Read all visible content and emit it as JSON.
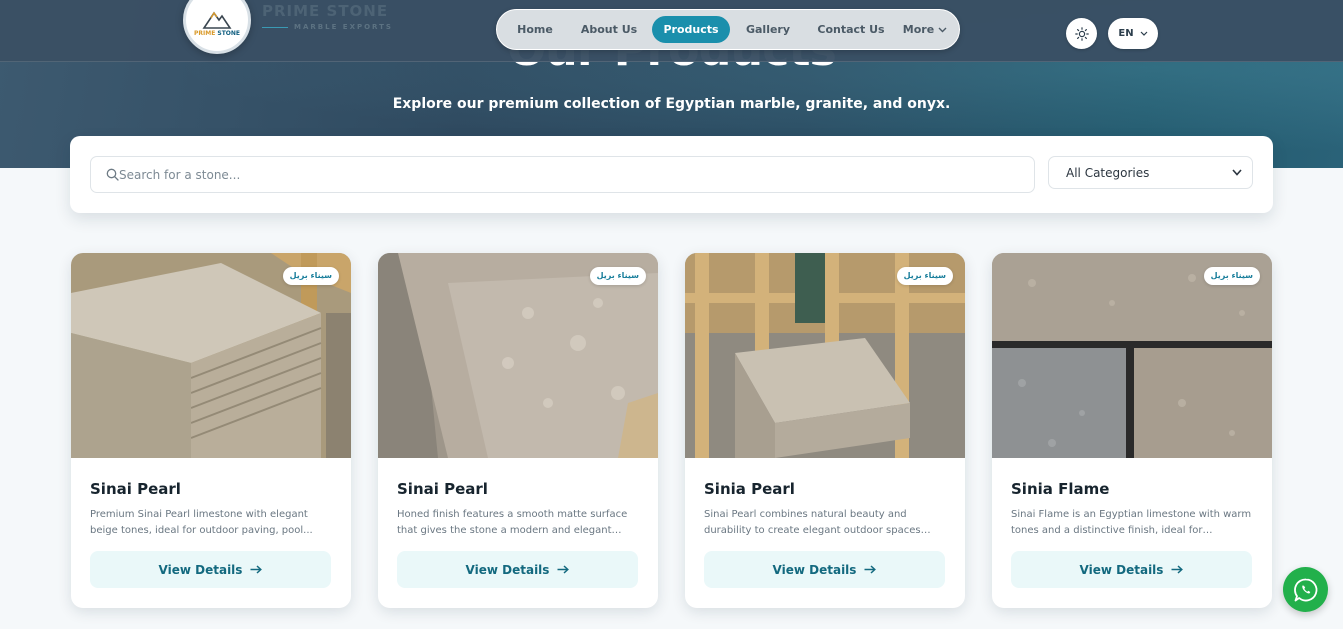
{
  "header": {
    "brand_name": "PRIME STONE",
    "brand_tagline": "MARBLE EXPORTS",
    "logo_text_a": "PRIME",
    "logo_text_b": "STONE",
    "nav": [
      {
        "label": "Home",
        "active": false
      },
      {
        "label": "About Us",
        "active": false
      },
      {
        "label": "Products",
        "active": true
      },
      {
        "label": "Gallery",
        "active": false
      },
      {
        "label": "Contact Us",
        "active": false
      },
      {
        "label": "More",
        "active": false
      }
    ],
    "language": "EN",
    "theme_icon": "sun-icon"
  },
  "hero": {
    "title": "Our Products",
    "subtitle": "Explore our premium collection of Egyptian marble, granite, and onyx."
  },
  "filters": {
    "search_placeholder": "Search for a stone...",
    "category_selected": "All Categories"
  },
  "products": [
    {
      "badge": "سيناء بريل",
      "title": "Sinai Pearl",
      "description": "Premium Sinai Pearl limestone with elegant beige tones, ideal for outdoor paving, pool...",
      "button": "View Details"
    },
    {
      "badge": "سيناء بريل",
      "title": "Sinai Pearl",
      "description": "Honed finish features a smooth matte surface that gives the stone a modern and elegant look...",
      "button": "View Details"
    },
    {
      "badge": "سيناء بريل",
      "title": "Sinia Pearl",
      "description": "Sinai Pearl combines natural beauty and durability to create elegant outdoor spaces buil...",
      "button": "View Details"
    },
    {
      "badge": "سيناء بريل",
      "title": "Sinia Flame",
      "description": "Sinai Flame is an Egyptian limestone with warm tones and a distinctive finish, ideal for outdoor...",
      "button": "View Details"
    }
  ],
  "colors": {
    "accent": "#1a8fac",
    "whatsapp": "#22b04b"
  },
  "chat_icon": "whatsapp-icon"
}
